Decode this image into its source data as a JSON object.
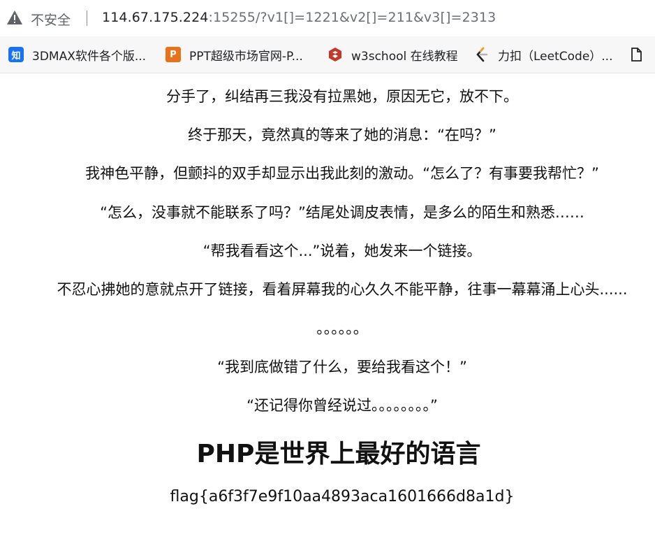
{
  "browser": {
    "security_label": "不安全",
    "url_host": "114.67.175.224",
    "url_rest": ":15255/?v1[]=1221&v2[]=211&v3[]=2313",
    "warning_icon": "warning-triangle-icon"
  },
  "bookmarks": [
    {
      "label": "3DMAX软件各个版...",
      "icon": "zhihu-icon",
      "icon_text": "知",
      "color": "#1772f6"
    },
    {
      "label": "PPT超级市场官网-P...",
      "icon": "ppt-market-icon",
      "icon_text": "P",
      "color": "#e8711b"
    },
    {
      "label": "w3school 在线教程",
      "icon": "w3school-icon",
      "icon_text": "",
      "color": "#c0392b"
    },
    {
      "label": "力扣（LeetCode）...",
      "icon": "leetcode-icon",
      "icon_text": "",
      "color": "#f89f1b"
    },
    {
      "label": "",
      "icon": "document-icon",
      "icon_text": "",
      "color": "#202124"
    }
  ],
  "content": {
    "lines": [
      "分手了，纠结再三我没有拉黑她，原因无它，放不下。",
      "终于那天，竟然真的等来了她的消息：“在吗？”",
      "我神色平静，但颤抖的双手却显示出我此刻的激动。“怎么了？有事要我帮忙？”",
      "“怎么，没事就不能联系了吗？”结尾处调皮表情，是多么的陌生和熟悉……",
      "“帮我看看这个...”说着，她发来一个链接。",
      "不忍心拂她的意就点开了链接，看着屏幕我的心久久不能平静，往事一幕幕涌上心头......",
      "。。。。。。",
      "“我到底做错了什么，要给我看这个！”",
      "“还记得你曾经说过。。。。。。。。”"
    ],
    "heading": "PHP是世界上最好的语言",
    "flag": "flag{a6f3f7e9f10aa4893aca1601666d8a1d}"
  }
}
